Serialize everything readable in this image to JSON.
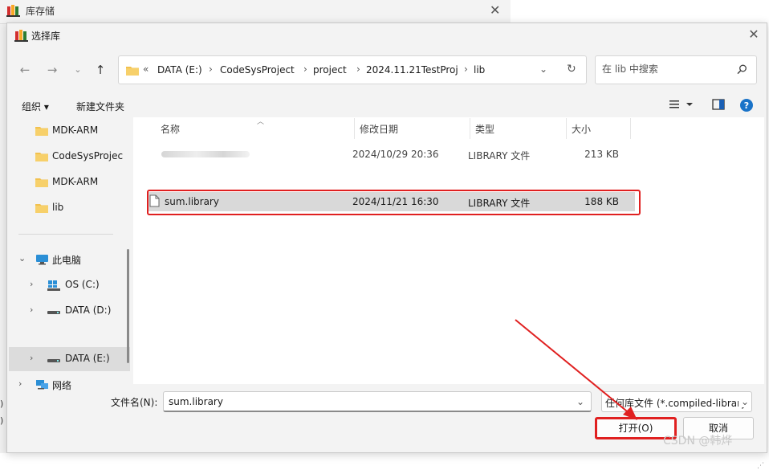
{
  "background_window": {
    "title": "库存储"
  },
  "dialog": {
    "title": "选择库",
    "address": {
      "overflow": "«",
      "crumbs": [
        "DATA (E:)",
        "CodeSysProject",
        "project",
        "2024.11.21TestProj",
        "lib"
      ]
    },
    "search": {
      "placeholder": "在 lib 中搜索"
    },
    "toolbar": {
      "organize": "组织 ▾",
      "new_folder": "新建文件夹"
    },
    "nav": [
      {
        "label": "MDK-ARM",
        "icon": "folder-icon"
      },
      {
        "label": "CodeSysProjec",
        "icon": "folder-icon"
      },
      {
        "label": "MDK-ARM",
        "icon": "folder-icon"
      },
      {
        "label": "lib",
        "icon": "folder-icon"
      },
      {
        "label": "此电脑",
        "icon": "computer-icon"
      },
      {
        "label": "OS (C:)",
        "icon": "windows-drive-icon"
      },
      {
        "label": "DATA (D:)",
        "icon": "drive-icon"
      },
      {
        "label": "DATA (E:)",
        "icon": "drive-icon"
      },
      {
        "label": "网络",
        "icon": "network-icon"
      }
    ],
    "columns": {
      "name": "名称",
      "modified": "修改日期",
      "type": "类型",
      "size": "大小"
    },
    "files": [
      {
        "name": "",
        "modified": "2024/10/29 20:36",
        "type": "LIBRARY 文件",
        "size": "213 KB"
      },
      {
        "name": "sum.library",
        "modified": "2024/11/21 16:30",
        "type": "LIBRARY 文件",
        "size": "188 KB"
      }
    ],
    "filename": {
      "label": "文件名(N):",
      "value": "sum.library"
    },
    "filetype": {
      "value": "任何库文件 (*.compiled-library"
    },
    "buttons": {
      "open": "打开(O)",
      "cancel": "取消"
    }
  },
  "watermark": "CSDN @韩烨",
  "colors": {
    "highlight": "#e02020",
    "selected_row": "#d9d9d9",
    "help": "#1a73c8",
    "folder": "#f2c14e"
  }
}
